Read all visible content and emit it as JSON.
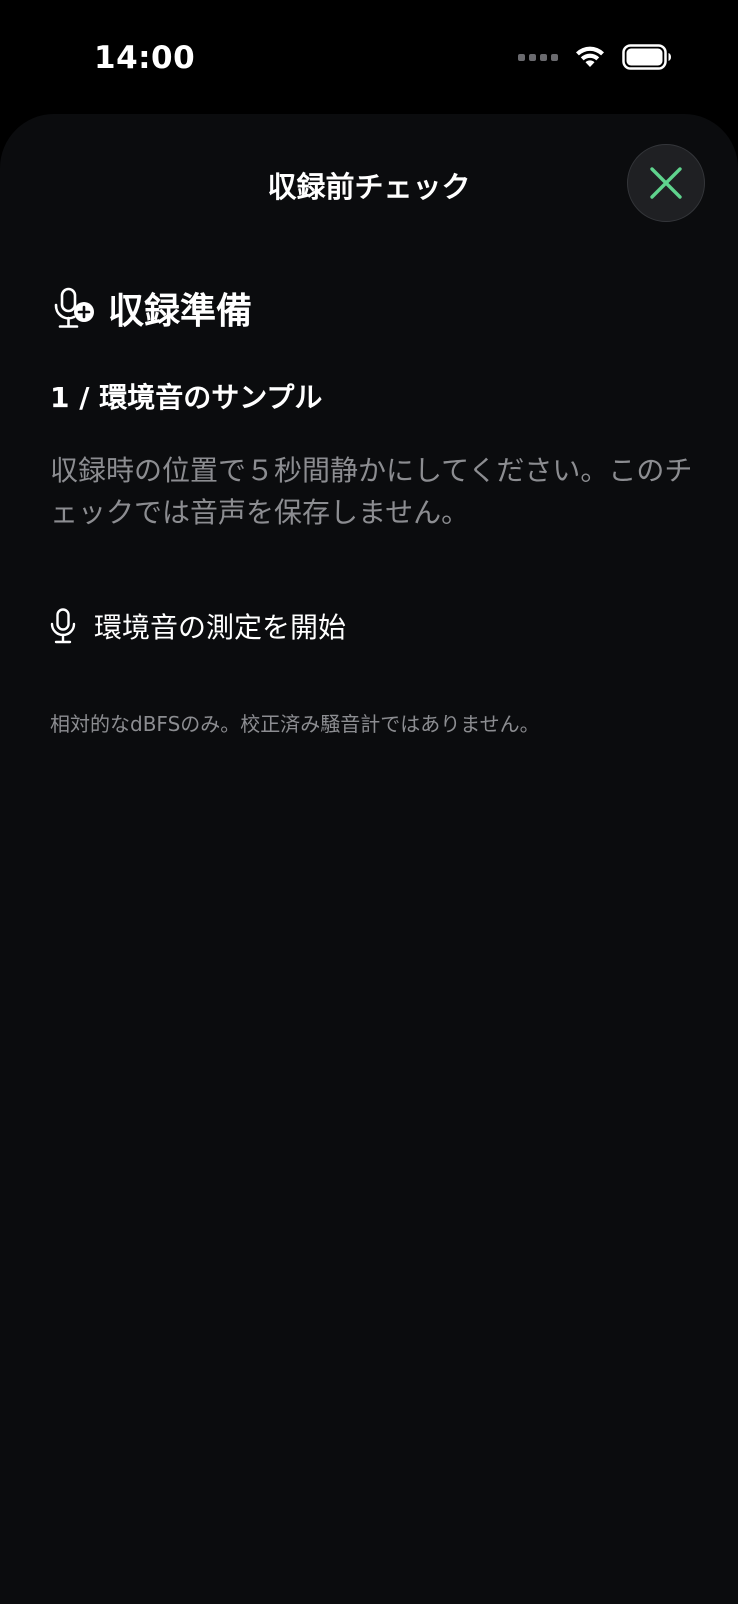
{
  "status_bar": {
    "time": "14:00"
  },
  "sheet": {
    "title": "収録前チェック",
    "close_icon": "close-x-icon",
    "accent_color": "#5fd38d"
  },
  "section": {
    "icon": "microphone-plus-icon",
    "title": "収録準備"
  },
  "step": {
    "label": "1 / 環境音のサンプル",
    "instruction": "収録時の位置で５秒間静かにしてください。このチェックでは音声を保存しません。"
  },
  "start_button": {
    "icon": "microphone-icon",
    "label": "環境音の測定を開始"
  },
  "disclaimer": "相対的なdBFSのみ。校正済み騒音計ではありません。"
}
